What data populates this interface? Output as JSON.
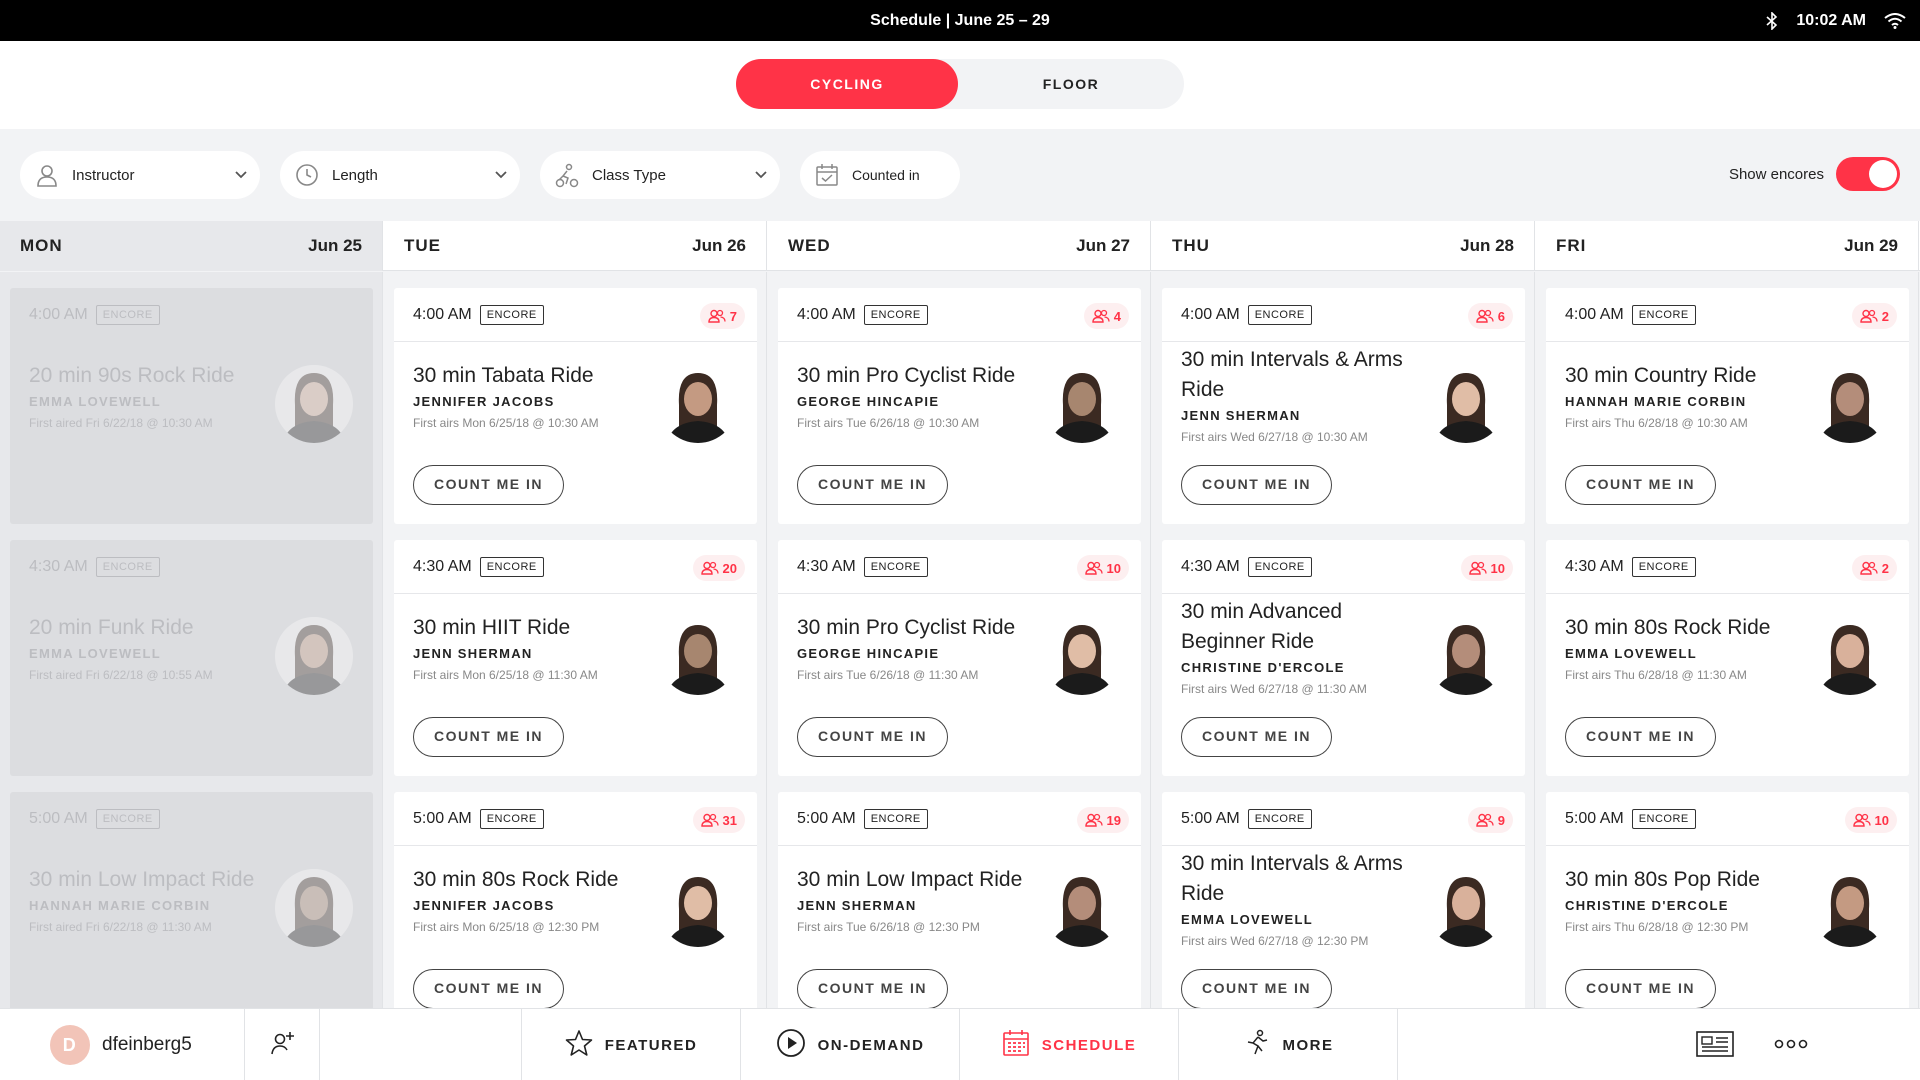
{
  "status_bar": {
    "title": "Schedule | June 25 – 29",
    "time": "10:02 AM"
  },
  "tabs": [
    {
      "label": "CYCLING",
      "active": true
    },
    {
      "label": "FLOOR",
      "active": false
    }
  ],
  "filters": {
    "instructor": "Instructor",
    "length": "Length",
    "class_type": "Class Type",
    "counted_in": "Counted in",
    "show_encores_label": "Show encores",
    "show_encores_on": true
  },
  "accent_color": "#ff3347",
  "days": [
    {
      "day": "MON",
      "date": "Jun 25",
      "past": true,
      "classes": [
        {
          "time": "4:00 AM",
          "badge": "ENCORE",
          "count": "",
          "title": "20 min 90s Rock Ride",
          "instructor": "EMMA LOVEWELL",
          "aired": "First aired Fri 6/22/18 @ 10:30 AM",
          "button": ""
        },
        {
          "time": "4:30 AM",
          "badge": "ENCORE",
          "count": "",
          "title": "20 min Funk Ride",
          "instructor": "EMMA LOVEWELL",
          "aired": "First aired Fri 6/22/18 @ 10:55 AM",
          "button": ""
        },
        {
          "time": "5:00 AM",
          "badge": "ENCORE",
          "count": "",
          "title": "30 min Low Impact Ride",
          "instructor": "HANNAH MARIE CORBIN",
          "aired": "First aired Fri 6/22/18 @ 11:30 AM",
          "button": ""
        }
      ]
    },
    {
      "day": "TUE",
      "date": "Jun 26",
      "past": false,
      "classes": [
        {
          "time": "4:00 AM",
          "badge": "ENCORE",
          "count": "7",
          "title": "30 min Tabata Ride",
          "instructor": "JENNIFER JACOBS",
          "aired": "First airs Mon 6/25/18 @ 10:30 AM",
          "button": "COUNT ME IN"
        },
        {
          "time": "4:30 AM",
          "badge": "ENCORE",
          "count": "20",
          "title": "30 min HIIT Ride",
          "instructor": "JENN SHERMAN",
          "aired": "First airs Mon 6/25/18 @ 11:30 AM",
          "button": "COUNT ME IN"
        },
        {
          "time": "5:00 AM",
          "badge": "ENCORE",
          "count": "31",
          "title": "30 min 80s Rock Ride",
          "instructor": "JENNIFER JACOBS",
          "aired": "First airs Mon 6/25/18 @ 12:30 PM",
          "button": "COUNT ME IN"
        }
      ]
    },
    {
      "day": "WED",
      "date": "Jun 27",
      "past": false,
      "classes": [
        {
          "time": "4:00 AM",
          "badge": "ENCORE",
          "count": "4",
          "title": "30 min Pro Cyclist Ride",
          "instructor": "GEORGE HINCAPIE",
          "aired": "First airs Tue 6/26/18 @ 10:30 AM",
          "button": "COUNT ME IN"
        },
        {
          "time": "4:30 AM",
          "badge": "ENCORE",
          "count": "10",
          "title": "30 min Pro Cyclist Ride",
          "instructor": "GEORGE HINCAPIE",
          "aired": "First airs Tue 6/26/18 @ 11:30 AM",
          "button": "COUNT ME IN"
        },
        {
          "time": "5:00 AM",
          "badge": "ENCORE",
          "count": "19",
          "title": "30 min Low Impact Ride",
          "instructor": "JENN SHERMAN",
          "aired": "First airs Tue 6/26/18 @ 12:30 PM",
          "button": "COUNT ME IN"
        }
      ]
    },
    {
      "day": "THU",
      "date": "Jun 28",
      "past": false,
      "classes": [
        {
          "time": "4:00 AM",
          "badge": "ENCORE",
          "count": "6",
          "title": "30 min Intervals & Arms Ride",
          "instructor": "JENN SHERMAN",
          "aired": "First airs Wed 6/27/18 @ 10:30 AM",
          "button": "COUNT ME IN"
        },
        {
          "time": "4:30 AM",
          "badge": "ENCORE",
          "count": "10",
          "title": "30 min Advanced Beginner Ride",
          "instructor": "CHRISTINE D'ERCOLE",
          "aired": "First airs Wed 6/27/18 @ 11:30 AM",
          "button": "COUNT ME IN"
        },
        {
          "time": "5:00 AM",
          "badge": "ENCORE",
          "count": "9",
          "title": "30 min Intervals & Arms Ride",
          "instructor": "EMMA LOVEWELL",
          "aired": "First airs Wed 6/27/18 @ 12:30 PM",
          "button": "COUNT ME IN"
        }
      ]
    },
    {
      "day": "FRI",
      "date": "Jun 29",
      "past": false,
      "classes": [
        {
          "time": "4:00 AM",
          "badge": "ENCORE",
          "count": "2",
          "title": "30 min Country Ride",
          "instructor": "HANNAH MARIE CORBIN",
          "aired": "First airs Thu 6/28/18 @ 10:30 AM",
          "button": "COUNT ME IN"
        },
        {
          "time": "4:30 AM",
          "badge": "ENCORE",
          "count": "2",
          "title": "30 min 80s Rock Ride",
          "instructor": "EMMA LOVEWELL",
          "aired": "First airs Thu 6/28/18 @ 11:30 AM",
          "button": "COUNT ME IN"
        },
        {
          "time": "5:00 AM",
          "badge": "ENCORE",
          "count": "10",
          "title": "30 min 80s Pop Ride",
          "instructor": "CHRISTINE D'ERCOLE",
          "aired": "First airs Thu 6/28/18 @ 12:30 PM",
          "button": "COUNT ME IN"
        }
      ]
    }
  ],
  "bottom_nav": {
    "avatar_initial": "D",
    "username": "dfeinberg5",
    "featured": "FEATURED",
    "on_demand": "ON-DEMAND",
    "schedule": "SCHEDULE",
    "more": "MORE"
  }
}
